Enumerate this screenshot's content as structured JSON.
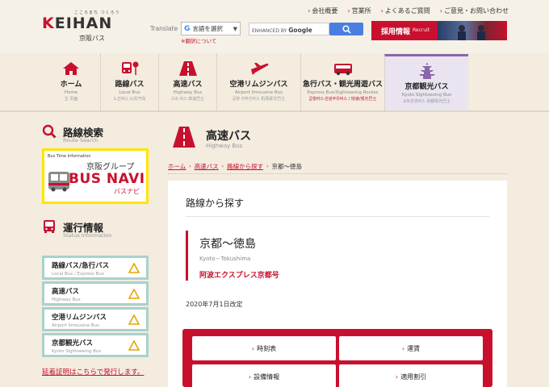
{
  "header": {
    "logo_kana": "こころまち つくろう",
    "logo_main_k": "K",
    "logo_main_rest": "EIHAN",
    "logo_div": "京阪バス",
    "links": [
      "会社概要",
      "営業所",
      "よくあるご質問",
      "ご意見・お問い合わせ"
    ],
    "translate_label": "Translate",
    "translate_select": "言語を選択",
    "translate_note": "※翻訳について",
    "search_enhanced": "ENHANCED BY",
    "search_google": "Google",
    "recruit_label": "採用情報",
    "recruit_en": "Recruit"
  },
  "nav": [
    {
      "label": "ホーム",
      "en": "Home",
      "kr": "主 页面"
    },
    {
      "label": "路線バス",
      "en": "Local Bus",
      "kr": "노선버스 公共汽车"
    },
    {
      "label": "高速バス",
      "en": "Highway Bus",
      "kr": "고속 버스 高速巴士"
    },
    {
      "label": "空港リムジンバス",
      "en": "Airport limousine Bus",
      "kr": "공항 리무진버스 机场豪华巴士"
    },
    {
      "label": "急行バス・観光周遊バス",
      "en": "Express Bus/Sightseeing Routes",
      "kr": "급행버스·관광주유버스 / 快速/观光巴士"
    },
    {
      "label": "京都観光バス",
      "en": "Kyoto Sightseeing Bus",
      "kr": "교토관광버스 京都观光巴士"
    }
  ],
  "sidebar": {
    "route_search": {
      "jp": "路線検索",
      "en": "Route Search"
    },
    "busnavi": {
      "small": "Bus Time Information",
      "group": "京阪グループ",
      "big": "BUS NAVI",
      "kana": "バスナビ"
    },
    "status": {
      "jp": "運行情報",
      "en": "Status Information"
    },
    "status_items": [
      {
        "jp": "路線バス/急行バス",
        "en": "Local Bus / Express Bus"
      },
      {
        "jp": "高速バス",
        "en": "Highway Bus"
      },
      {
        "jp": "空港リムジンバス",
        "en": "Airport limousine Bus"
      },
      {
        "jp": "京都観光バス",
        "en": "Kyoto Sightseeing Bus"
      }
    ],
    "delay_link": "延着証明はこちらで発行します。"
  },
  "main": {
    "title": "高速バス",
    "title_en": "Highway Bus",
    "breadcrumb": [
      "ホーム",
      "高速バス",
      "路線から探す",
      "京都〜徳島"
    ],
    "section_title": "路線から探す",
    "route_name": "京都〜徳島",
    "route_en": "Kyoto－Tokushima",
    "route_line": "阿波エクスプレス京都号",
    "revised": "2020年7月1日改定",
    "menu": [
      "時刻表",
      "運賃",
      "設備情報",
      "適用割引"
    ]
  },
  "colors": {
    "brand_red": "#c8102e",
    "background": "#f3ecdf",
    "nav_active": "#8a66a8",
    "status_border": "#a9d1cc",
    "busnavi_border": "#ffe500"
  },
  "icons": {
    "route_search": "magnifier-icon",
    "status": "bus-front-icon",
    "highway": "highway-road-icon",
    "status_triangle": "warning-triangle-icon"
  }
}
